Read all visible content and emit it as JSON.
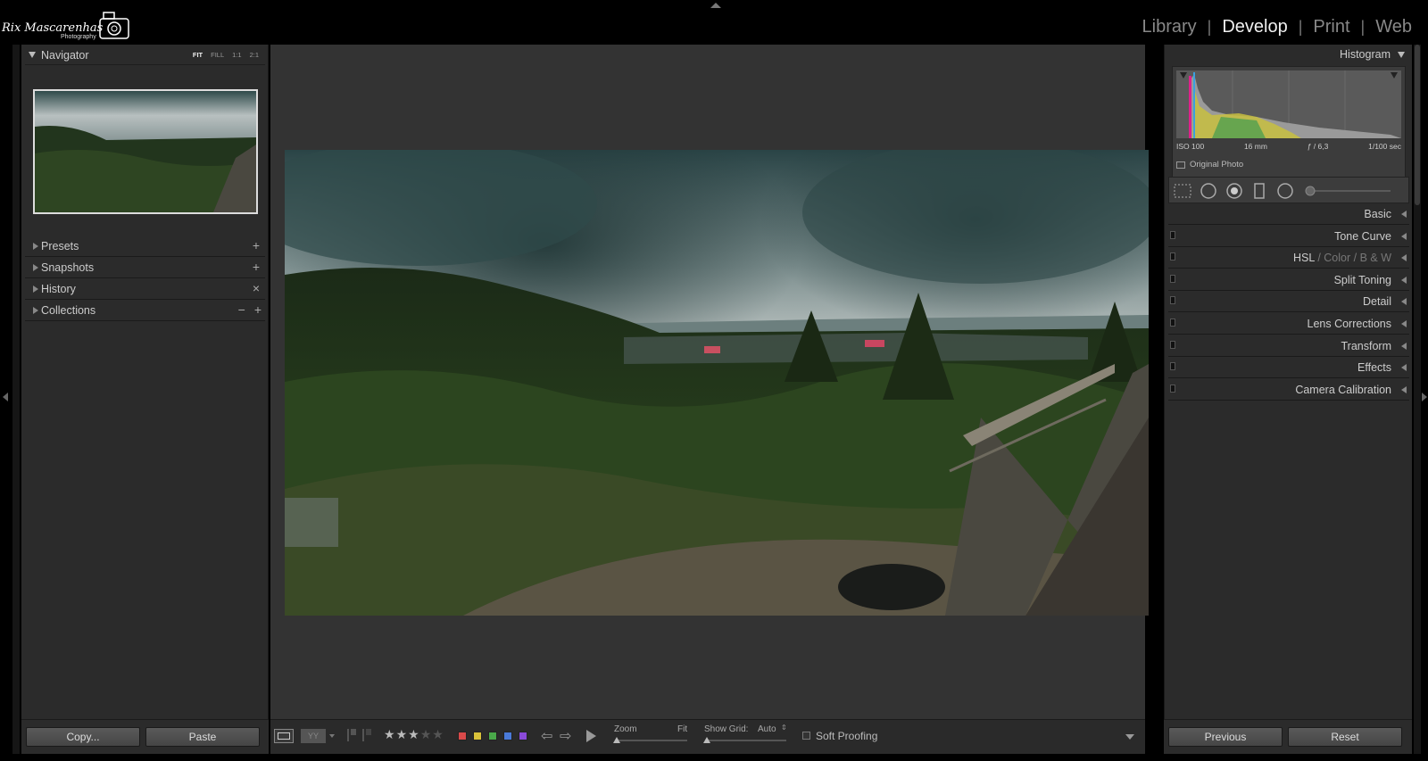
{
  "app": {
    "logo_text": "Rix Mascarenhas",
    "logo_subtext": "Photography",
    "modules": [
      {
        "label": "Library",
        "active": false
      },
      {
        "label": "Develop",
        "active": true
      },
      {
        "label": "Print",
        "active": false
      },
      {
        "label": "Web",
        "active": false
      }
    ]
  },
  "left": {
    "navigator": {
      "title": "Navigator",
      "zoom_options": [
        "FIT",
        "FILL",
        "1:1",
        "2:1"
      ],
      "selected_zoom": "FIT"
    },
    "sections": [
      {
        "label": "Presets",
        "action": "+"
      },
      {
        "label": "Snapshots",
        "action": "+"
      },
      {
        "label": "History",
        "action": "×"
      },
      {
        "label": "Collections",
        "action": "−",
        "action2": "+"
      }
    ],
    "copy_label": "Copy...",
    "paste_label": "Paste"
  },
  "toolbar": {
    "rating_stars": 3,
    "rating_max": 5,
    "color_labels": [
      "#d94a4a",
      "#d9c23a",
      "#4aa84a",
      "#4a7ad9",
      "#8a4ad9"
    ],
    "zoom_label": "Zoom",
    "zoom_value": "Fit",
    "show_grid_label": "Show Grid:",
    "show_grid_value": "Auto",
    "soft_proofing_label": "Soft Proofing"
  },
  "right": {
    "histogram_title": "Histogram",
    "iso": "ISO 100",
    "focal": "16 mm",
    "aperture": "ƒ / 6,3",
    "shutter": "1/100 sec",
    "original_photo_label": "Original Photo",
    "sections": [
      {
        "label": "Basic",
        "switch": false
      },
      {
        "label": "Tone Curve",
        "switch": true
      },
      {
        "label": "HSL",
        "switch": true
      },
      {
        "label": "Split Toning",
        "switch": true
      },
      {
        "label": "Detail",
        "switch": true
      },
      {
        "label": "Lens Corrections",
        "switch": true
      },
      {
        "label": "Transform",
        "switch": true
      },
      {
        "label": "Effects",
        "switch": true
      },
      {
        "label": "Camera Calibration",
        "switch": true
      }
    ],
    "hsl_color": "Color",
    "hsl_bw": "B & W",
    "previous_label": "Previous",
    "reset_label": "Reset"
  }
}
